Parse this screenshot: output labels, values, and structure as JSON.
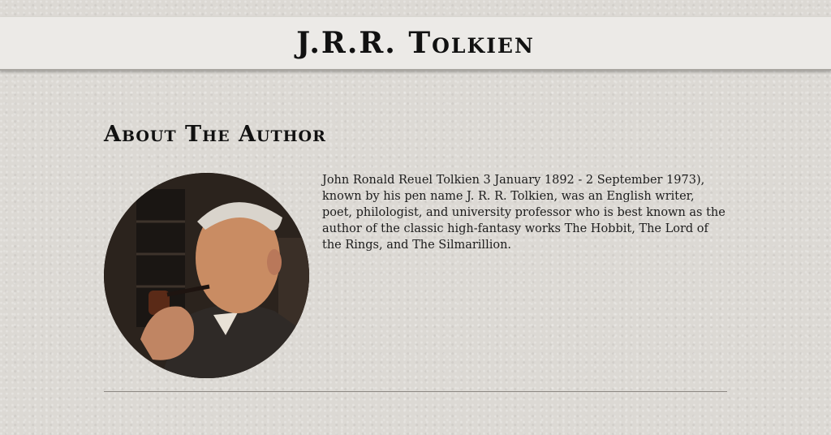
{
  "header": {
    "title": "J.R.R. Tolkien"
  },
  "about": {
    "heading": "About The Author",
    "portrait_icon": "author-portrait",
    "bio": "John Ronald Reuel Tolkien 3 January 1892 - 2 September 1973), known by his pen name J. R. R. Tolkien, was an English writer, poet, philologist, and university professor who is best known as the author of the classic high-fantasy works The Hobbit, The Lord of the Rings, and The Silmarillion."
  },
  "colors": {
    "background": "#dcd9d4",
    "header_bar": "#eceae7",
    "text": "#1b1b1b",
    "divider": "#8c8883"
  }
}
